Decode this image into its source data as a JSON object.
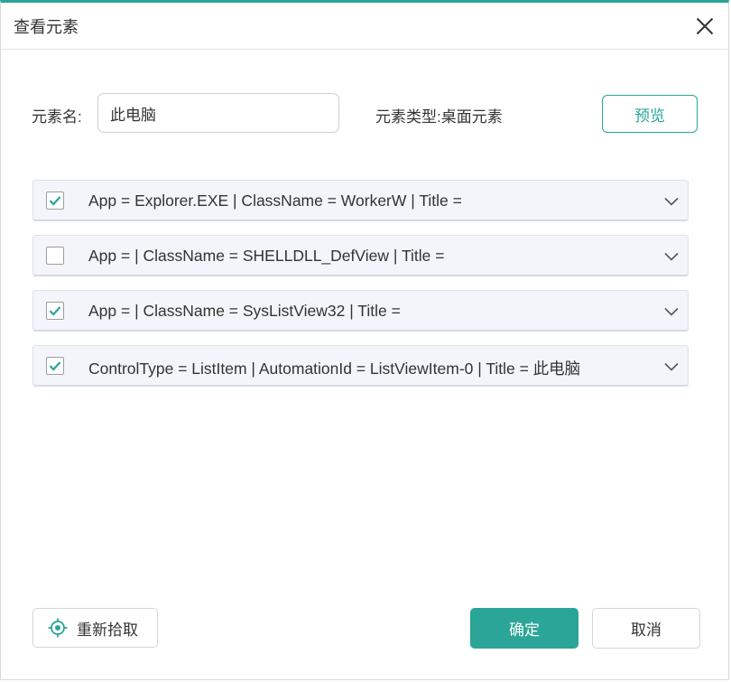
{
  "dialog": {
    "title": "查看元素",
    "close_icon": "close-icon"
  },
  "element": {
    "name_label": "元素名:",
    "name_value": "此电脑",
    "type_text": "元素类型:桌面元素",
    "preview_label": "预览"
  },
  "selectors": [
    {
      "checked": true,
      "text": "App = Explorer.EXE | ClassName = WorkerW | Title ="
    },
    {
      "checked": false,
      "text": "App =  | ClassName = SHELLDLL_DefView | Title ="
    },
    {
      "checked": true,
      "text": "App =  | ClassName = SysListView32 | Title ="
    },
    {
      "checked": true,
      "text": "ControlType = ListItem | AutomationId = ListViewItem-0 | Title = 此电脑"
    }
  ],
  "footer": {
    "repick_label": "重新拾取",
    "repick_icon": "crosshair-icon",
    "ok_label": "确定",
    "cancel_label": "取消"
  },
  "colors": {
    "accent": "#2aa597",
    "row_bg": "#f4f5fa"
  }
}
